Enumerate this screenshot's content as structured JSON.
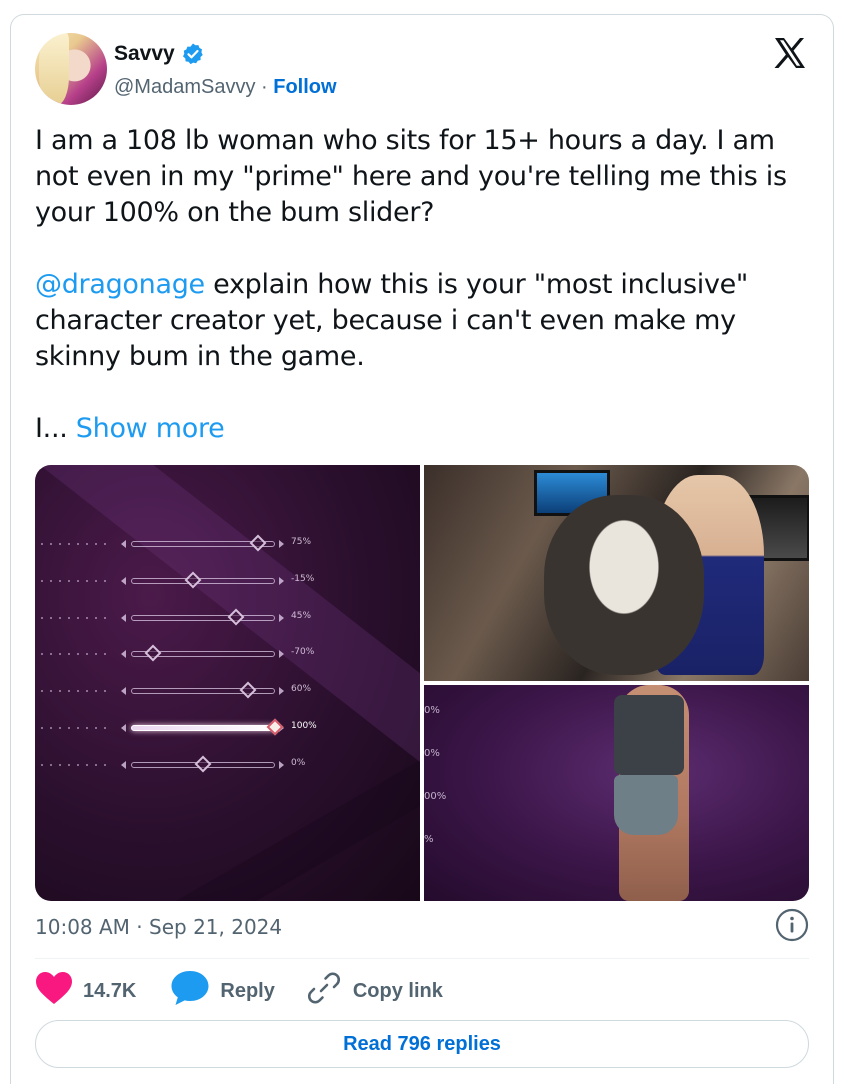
{
  "author": {
    "name": "Savvy",
    "handle": "@MadamSavvy",
    "separator": " · ",
    "follow_label": "Follow",
    "verified_color": "#1d9bf0"
  },
  "tweet": {
    "paragraph1": "I am a 108 lb woman who sits for 15+ hours a day. I am not even in my \"prime\" here and you're telling me this is your 100% on the bum slider?",
    "mention": "@dragonage",
    "paragraph2_rest": " explain how this is your \"most inclusive\" character creator yet, because i can't even make my skinny bum in the game.",
    "truncated": "I... ",
    "show_more": "Show more"
  },
  "media": {
    "sliders": [
      {
        "pct": "75%",
        "value": 0.88,
        "active": false
      },
      {
        "pct": "-15%",
        "value": 0.43,
        "active": false
      },
      {
        "pct": "45%",
        "value": 0.73,
        "active": false
      },
      {
        "pct": "-70%",
        "value": 0.15,
        "active": false
      },
      {
        "pct": "60%",
        "value": 0.81,
        "active": false
      },
      {
        "pct": "100%",
        "value": 1.0,
        "active": true
      },
      {
        "pct": "0%",
        "value": 0.5,
        "active": false
      }
    ],
    "cropped_labels": [
      "0%",
      "0%",
      "00%",
      "%"
    ]
  },
  "meta": {
    "time": "10:08 AM",
    "separator": " · ",
    "date": "Sep 21, 2024"
  },
  "actions": {
    "likes": "14.7K",
    "reply": "Reply",
    "copy_link": "Copy link",
    "like_color": "#f91880",
    "reply_color": "#1d9bf0"
  },
  "read_replies": "Read 796 replies"
}
